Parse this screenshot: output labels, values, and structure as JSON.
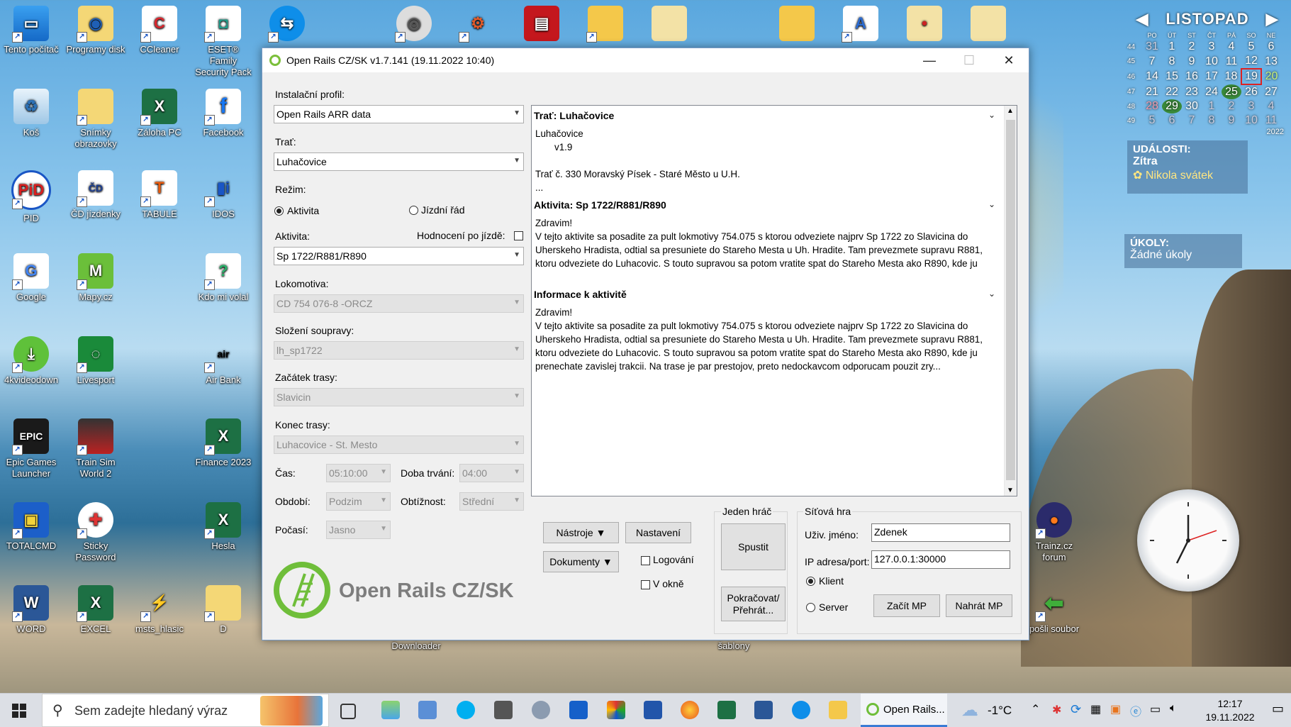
{
  "desktop": {
    "icons": [
      {
        "label": "Tento počítač"
      },
      {
        "label": "Programy disk"
      },
      {
        "label": "CCleaner"
      },
      {
        "label": "ESET® Family Security Pack"
      },
      {
        "label": "Koš"
      },
      {
        "label": "Snímky obrazovky"
      },
      {
        "label": "Záloha PC"
      },
      {
        "label": "Facebook"
      },
      {
        "label": "PID"
      },
      {
        "label": "ČD jízdenky"
      },
      {
        "label": "TABULE"
      },
      {
        "label": "IDOS"
      },
      {
        "label": "Google"
      },
      {
        "label": "Mapy.cz"
      },
      {
        "label": "Kdo mi volal"
      },
      {
        "label": "4kvideodown"
      },
      {
        "label": "Livesport"
      },
      {
        "label": "Air Bank"
      },
      {
        "label": "Epic Games Launcher"
      },
      {
        "label": "Train Sim World 2"
      },
      {
        "label": "Finance 2023"
      },
      {
        "label": "TOTALCMD"
      },
      {
        "label": "Sticky Password"
      },
      {
        "label": "Hesla"
      },
      {
        "label": "WORD"
      },
      {
        "label": "EXCEL"
      },
      {
        "label": "msts_hlasic"
      },
      {
        "label": "D"
      },
      {
        "label": "Trainz.cz forum"
      },
      {
        "label": "pošli soubor"
      },
      {
        "label": "Downloader"
      },
      {
        "label": "šablony"
      }
    ]
  },
  "calendar": {
    "month": "LISTOPAD",
    "year": "2022",
    "weekdays": [
      "PO",
      "ÚT",
      "ST",
      "ČT",
      "PÁ",
      "SO",
      "NE"
    ],
    "rows": [
      {
        "week": "44",
        "days": [
          "31",
          "1",
          "2",
          "3",
          "4",
          "5",
          "6"
        ]
      },
      {
        "week": "45",
        "days": [
          "7",
          "8",
          "9",
          "10",
          "11",
          "12",
          "13"
        ]
      },
      {
        "week": "46",
        "days": [
          "14",
          "15",
          "16",
          "17",
          "18",
          "19",
          "20"
        ]
      },
      {
        "week": "47",
        "days": [
          "21",
          "22",
          "23",
          "24",
          "25",
          "26",
          "27"
        ]
      },
      {
        "week": "48",
        "days": [
          "28",
          "29",
          "30",
          "1",
          "2",
          "3",
          "4"
        ]
      },
      {
        "week": "49",
        "days": [
          "5",
          "6",
          "7",
          "8",
          "9",
          "10",
          "11"
        ]
      }
    ],
    "events_title": "UDÁLOSTI:",
    "events_day": "Zítra",
    "events_item": "Nikola svátek",
    "tasks_title": "ÚKOLY:",
    "tasks_item": "Žádné úkoly"
  },
  "window": {
    "title": "Open Rails CZ/SK v1.7.141 (19.11.2022 10:40)",
    "profile_label": "Instalační profil:",
    "profile_value": "Open Rails ARR data",
    "route_label": "Trať:",
    "route_value": "Luhačovice",
    "mode_label": "Režim:",
    "mode_activity": "Aktivita",
    "mode_timetable": "Jízdní řád",
    "activity_label": "Aktivita:",
    "rating_label": "Hodnocení po jízdě:",
    "activity_value": "Sp 1722/R881/R890",
    "loco_label": "Lokomotiva:",
    "loco_value": "CD 754 076-8 -ORCZ",
    "consist_label": "Složení soupravy:",
    "consist_value": "lh_sp1722",
    "start_label": "Začátek trasy:",
    "start_value": "Slavicin",
    "end_label": "Konec trasy:",
    "end_value": "Luhacovice - St. Mesto",
    "time_label": "Čas:",
    "time_value": "05:10:00",
    "duration_label": "Doba trvání:",
    "duration_value": "04:00",
    "season_label": "Období:",
    "season_value": "Podzim",
    "difficulty_label": "Obtížnost:",
    "difficulty_value": "Střední",
    "weather_label": "Počasí:",
    "weather_value": "Jasno",
    "logo_text": "Open Rails CZ/SK",
    "info": {
      "route_header": "Trať: Luhačovice",
      "route_name": "Luhačovice",
      "route_version": "v1.9",
      "route_desc": "Trať č. 330 Moravský Písek - Staré Město u U.H.",
      "route_more": "...",
      "activity_header": "Aktivita: Sp 1722/R881/R890",
      "activity_text": "Zdravim!\nV tejto aktivite sa posadite za pult lokmotivy 754.075 s ktorou odveziete najprv Sp 1722 zo Slavicina do Uherskeho Hradista, odtial sa presuniete do Stareho Mesta u Uh. Hradite. Tam prevezmete supravu R881, ktoru odveziete do Luhacovic. S touto supravou sa potom vratite spat do Stareho Mesta ako R890, kde ju prenechate zavislej trakcii. Na trase je par prestojov, preto odporucam pouzit zry...",
      "info_header": "Informace k aktivitě",
      "info_text": "Zdravim!\nV tejto aktivite sa posadite za pult lokmotivy 754.075 s ktorou odveziete najprv Sp 1722 zo Slavicina do Uherskeho Hradista, odtial sa presuniete do Stareho Mesta u Uh. Hradite. Tam prevezmete supravu R881, ktoru odveziete do Luhacovic. S touto supravou sa potom vratite spat do Stareho Mesta ako R890, kde ju prenechate zavislej trakcii. Na trase je par prestojov, preto nedockavcom odporucam pouzit zry..."
    },
    "tools_button": "Nástroje ▼",
    "settings_button": "Nastavení",
    "docs_button": "Dokumenty ▼",
    "logging_label": "Logování",
    "windowed_label": "V okně",
    "single_title": "Jeden hráč",
    "start_button": "Spustit",
    "resume_button_line1": "Pokračovat/",
    "resume_button_line2": "Přehrát...",
    "mp_title": "Síťová hra",
    "user_label": "Uživ. jméno:",
    "user_value": "Zdenek",
    "ip_label": "IP adresa/port:",
    "ip_value": "127.0.0.1:30000",
    "client_label": "Klient",
    "server_label": "Server",
    "start_mp_button": "Začít MP",
    "load_mp_button": "Nahrát MP"
  },
  "taskbar": {
    "search_placeholder": "Sem zadejte hledaný výraz",
    "active_app": "Open Rails...",
    "temperature": "-1°C",
    "time": "12:17",
    "date": "19.11.2022"
  }
}
